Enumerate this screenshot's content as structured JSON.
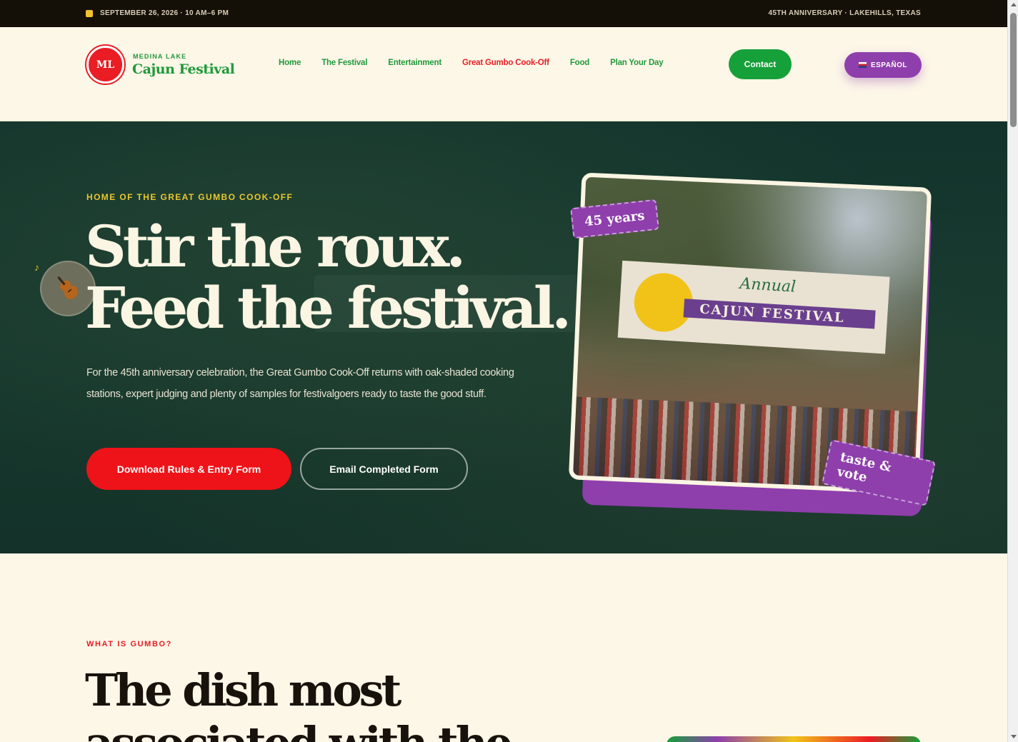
{
  "topbar": {
    "date_text": "SEPTEMBER 26, 2026 · 10 AM–6 PM",
    "anniversary_text": "45TH ANNIVERSARY · LAKEHILLS, TEXAS",
    "calendar_icon": "calendar-icon"
  },
  "header": {
    "logo_badge": "ML",
    "logo_top": "MEDINA LAKE",
    "logo_main": "Cajun Festival",
    "nav": [
      {
        "label": "Home"
      },
      {
        "label": "The Festival"
      },
      {
        "label": "Entertainment"
      },
      {
        "label": "Great Gumbo Cook-Off",
        "active": true
      },
      {
        "label": "Food"
      },
      {
        "label": "Plan Your Day"
      }
    ],
    "contact_label": "Contact",
    "language_label": "ESPAÑOL",
    "language_icon": "flag-icon"
  },
  "hero": {
    "kicker": "HOME OF THE GREAT GUMBO COOK-OFF",
    "headline_line1": "Stir the roux.",
    "headline_line2": "Feed the festival.",
    "paragraph": "For the 45th anniversary celebration, the Great Gumbo Cook-Off returns with oak-shaded cooking stations, expert judging and plenty of samples for festivalgoers ready to taste the good stuff.",
    "primary_button": "Download Rules & Entry Form",
    "secondary_button": "Email Completed Form",
    "photo": {
      "banner_annual": "Annual",
      "banner_title": "CAJUN FESTIVAL",
      "tag_years": "45 years",
      "tag_taste": "taste & vote"
    },
    "badge_icon": "fiddle-icon",
    "note_icon": "music-note-icon"
  },
  "section_gumbo": {
    "kicker": "WHAT IS GUMBO?",
    "title": "The dish most associated with the"
  },
  "colors": {
    "green": "#1f9a3a",
    "red": "#ea1c24",
    "purple": "#8e3fac",
    "gold": "#e9c62f",
    "hero_bg": "#143229",
    "cream": "#fdf7e8"
  }
}
